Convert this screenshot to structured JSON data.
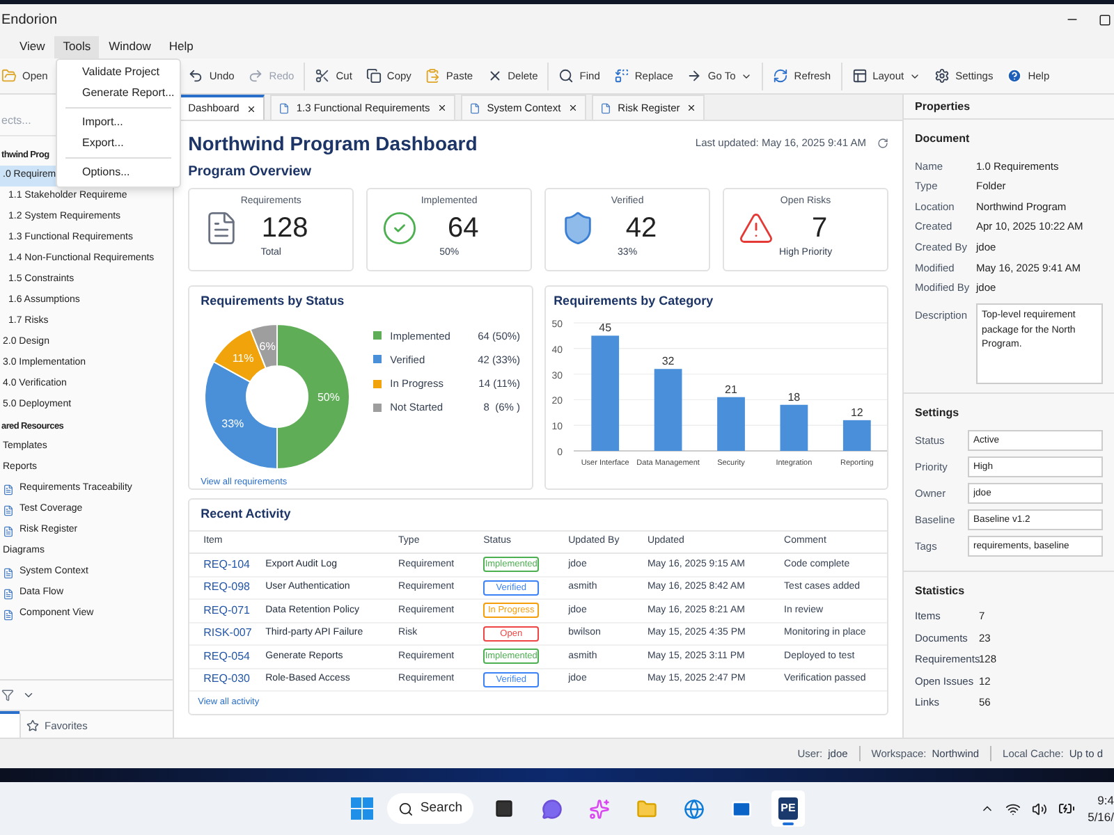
{
  "window": {
    "title": "Endorion"
  },
  "menu_bar": [
    {
      "label": "View",
      "selected": false
    },
    {
      "label": "Tools",
      "selected": true
    },
    {
      "label": "Window",
      "selected": false
    },
    {
      "label": "Help",
      "selected": false
    }
  ],
  "tools_menu": [
    {
      "kind": "item",
      "label": "Validate Project"
    },
    {
      "kind": "item",
      "label": "Generate Report..."
    },
    {
      "kind": "separator"
    },
    {
      "kind": "item",
      "label": "Import..."
    },
    {
      "kind": "item",
      "label": "Export..."
    },
    {
      "kind": "separator"
    },
    {
      "kind": "item",
      "label": "Options..."
    }
  ],
  "toolbar": [
    [
      {
        "label": "Open",
        "disabled": false
      }
    ],
    [
      {
        "label": "Undo",
        "disabled": false
      },
      {
        "label": "Redo",
        "disabled": true
      }
    ],
    [
      {
        "label": "Cut",
        "disabled": false
      },
      {
        "label": "Copy",
        "disabled": false
      },
      {
        "label": "Paste",
        "disabled": false
      },
      {
        "label": "Delete",
        "disabled": false
      }
    ],
    [
      {
        "label": "Find",
        "disabled": false
      },
      {
        "label": "Replace",
        "disabled": false
      },
      {
        "label": "Go To",
        "disabled": false,
        "dropdown": true
      }
    ],
    [
      {
        "label": "Refresh",
        "disabled": false
      }
    ],
    [
      {
        "label": "Layout",
        "disabled": false,
        "dropdown": true
      },
      {
        "label": "Settings",
        "disabled": false
      },
      {
        "label": "Help",
        "disabled": false
      }
    ]
  ],
  "sidebar": {
    "search": {
      "placeholder": "ects..."
    },
    "tree": [
      {
        "label": "thwind Prog",
        "selected": false,
        "children": [
          {
            "label": ".0 Requirem",
            "selected": true,
            "children": [
              {
                "label": "1.1  Stakeholder Requireme",
                "selected": false
              },
              {
                "label": "1.2  System Requirements",
                "selected": false
              },
              {
                "label": "1.3  Functional Requirements",
                "selected": false
              },
              {
                "label": "1.4  Non-Functional Requirements",
                "selected": false
              },
              {
                "label": "1.5  Constraints",
                "selected": false
              },
              {
                "label": "1.6  Assumptions",
                "selected": false
              },
              {
                "label": "1.7  Risks",
                "selected": false
              }
            ]
          },
          {
            "label": "2.0  Design",
            "selected": false
          },
          {
            "label": "3.0  Implementation",
            "selected": false
          },
          {
            "label": "4.0  Verification",
            "selected": false
          },
          {
            "label": "5.0  Deployment",
            "selected": false
          }
        ]
      },
      {
        "label": "ared Resources",
        "selected": false,
        "children": [
          {
            "label": "Templates",
            "selected": false
          },
          {
            "label": "Reports",
            "selected": false,
            "children": [
              {
                "label": "Requirements Traceability",
                "selected": false
              },
              {
                "label": "Test Coverage",
                "selected": false
              },
              {
                "label": "Risk Register",
                "selected": false
              }
            ]
          },
          {
            "label": "Diagrams",
            "selected": false,
            "children": [
              {
                "label": "System Context",
                "selected": false
              },
              {
                "label": "Data Flow",
                "selected": false
              },
              {
                "label": "Component View",
                "selected": false
              }
            ]
          }
        ]
      }
    ],
    "bottom_tabs": [
      {
        "selected": true
      },
      {
        "label": "Favorites",
        "selected": false
      }
    ]
  },
  "doc_tabs": [
    {
      "label": "Dashboard",
      "selected": true
    },
    {
      "label": "1.3 Functional Requirements",
      "selected": false
    },
    {
      "label": "System Context",
      "selected": false
    },
    {
      "label": "Risk Register",
      "selected": false
    }
  ],
  "dashboard": {
    "title": "Northwind Program Dashboard",
    "last_updated": "Last updated: May 16, 2025 9:41 AM",
    "section": "Program Overview",
    "kpis": [
      {
        "label": "Requirements",
        "value": "128",
        "sub": "Total"
      },
      {
        "label": "Implemented",
        "value": "64",
        "sub": "50%"
      },
      {
        "label": "Verified",
        "value": "42",
        "sub": "33%"
      },
      {
        "label": "Open Risks",
        "value": "7",
        "sub": "High Priority"
      }
    ],
    "status_chart": {
      "title": "Requirements by Status",
      "link": "View all requirements",
      "chart_data": {
        "type": "donut",
        "categories": [
          "Implemented",
          "Verified",
          "In Progress",
          "Not Started"
        ],
        "values": [
          50,
          33,
          11,
          6
        ],
        "value_labels": [
          "50%",
          "33%",
          "11%",
          "6%"
        ]
      },
      "legend": [
        {
          "count": "64 (50%)",
          "color": "#5fad56"
        },
        {
          "count": "42 (33%)",
          "color": "#4a90d9"
        },
        {
          "count": "14 (11%)",
          "color": "#f0a30a"
        },
        {
          "count": "8  (6% )",
          "color": "#9e9e9e"
        }
      ]
    },
    "category_chart": {
      "title": "Requirements by Category",
      "chart_data": {
        "type": "bar",
        "categories": [
          "User Interface",
          "Data Management",
          "Security",
          "Integration",
          "Reporting"
        ],
        "values": [
          45,
          32,
          21,
          18,
          12
        ],
        "ylim": [
          0,
          50
        ],
        "yticks": [
          0,
          10,
          20,
          30,
          40,
          50
        ],
        "grid": true,
        "data_labels": true
      }
    },
    "activity": {
      "title": "Recent Activity",
      "link": "View all activity",
      "columns": [
        "Item",
        "Type",
        "Status",
        "Updated By",
        "Updated",
        "Comment"
      ],
      "rows": [
        {
          "item": "REQ-104",
          "name": "Export Audit Log",
          "type": "Requirement",
          "status": "Implemented",
          "color": "#4caf50",
          "by": "jdoe",
          "updated": "May 16, 2025 9:15 AM",
          "comment": "Code complete"
        },
        {
          "item": "REQ-098",
          "name": "User Authentication",
          "type": "Requirement",
          "status": "Verified",
          "color": "#3b82f6",
          "by": "asmith",
          "updated": "May 16, 2025 8:42 AM",
          "comment": "Test cases added"
        },
        {
          "item": "REQ-071",
          "name": "Data Retention Policy",
          "type": "Requirement",
          "status": "In Progress",
          "color": "#f59e0b",
          "by": "jdoe",
          "updated": "May 16, 2025 8:21 AM",
          "comment": "In review"
        },
        {
          "item": "RISK-007",
          "name": "Third-party API Failure",
          "type": "Risk",
          "status": "Open",
          "color": "#ef4444",
          "by": "bwilson",
          "updated": "May 15, 2025 4:35 PM",
          "comment": "Monitoring in place"
        },
        {
          "item": "REQ-054",
          "name": "Generate Reports",
          "type": "Requirement",
          "status": "Implemented",
          "color": "#4caf50",
          "by": "asmith",
          "updated": "May 15, 2025 3:11 PM",
          "comment": "Deployed to test"
        },
        {
          "item": "REQ-030",
          "name": "Role-Based Access",
          "type": "Requirement",
          "status": "Verified",
          "color": "#3b82f6",
          "by": "jdoe",
          "updated": "May 15, 2025 2:47 PM",
          "comment": "Verification passed"
        }
      ]
    }
  },
  "properties": {
    "title": "Properties",
    "document": {
      "title": "Document",
      "rows": [
        {
          "label": "Name",
          "value": "1.0 Requirements"
        },
        {
          "label": "Type",
          "value": "Folder"
        },
        {
          "label": "Location",
          "value": "Northwind Program"
        },
        {
          "label": "Created",
          "value": "Apr 10, 2025 10:22 AM"
        },
        {
          "label": "Created By",
          "value": "jdoe"
        },
        {
          "label": "Modified",
          "value": "May 16, 2025 9:41 AM"
        },
        {
          "label": "Modified By",
          "value": "jdoe"
        }
      ],
      "description": {
        "label": "Description",
        "lines": [
          "Top-level requirement",
          "package for the North",
          "Program."
        ]
      }
    },
    "settings": {
      "title": "Settings",
      "fields": [
        {
          "label": "Status",
          "value": "Active"
        },
        {
          "label": "Priority",
          "value": "High"
        },
        {
          "label": "Owner",
          "value": "jdoe"
        },
        {
          "label": "Baseline",
          "value": "Baseline v1.2"
        },
        {
          "label": "Tags",
          "value": "requirements, baseline"
        }
      ]
    },
    "statistics": {
      "title": "Statistics",
      "rows": [
        {
          "label": "Items",
          "value": "7"
        },
        {
          "label": "Documents",
          "value": "23"
        },
        {
          "label": "Requirements",
          "value": "128"
        },
        {
          "label": "Open Issues",
          "value": "12"
        },
        {
          "label": "Links",
          "value": "56"
        }
      ]
    }
  },
  "status_bar": [
    {
      "label": "User:",
      "value": "jdoe"
    },
    {
      "label": "Workspace:",
      "value": "Northwind"
    },
    {
      "label": "Local Cache:",
      "value": "Up to d"
    }
  ],
  "taskbar": {
    "search": "Search",
    "apps": [
      {
        "selected": false
      },
      {
        "selected": false
      },
      {
        "selected": false
      },
      {
        "selected": false
      },
      {
        "selected": false
      },
      {
        "selected": false
      },
      {
        "label": "PE",
        "selected": true
      }
    ],
    "time": "9:4",
    "date": "5/16/"
  }
}
